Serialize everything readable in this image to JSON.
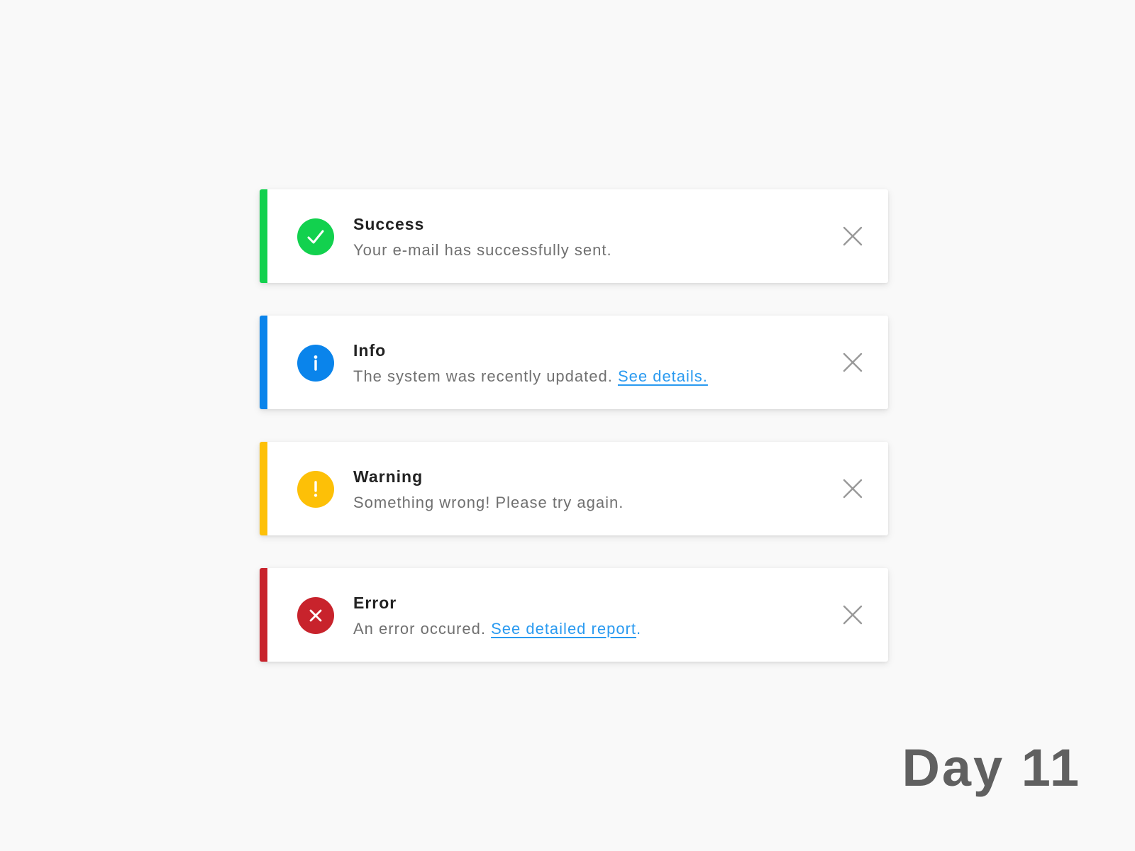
{
  "colors": {
    "success": "#12d14e",
    "info": "#0a84eb",
    "warning": "#fdc007",
    "error": "#c8232c",
    "link": "#2a9af0",
    "close": "#999999"
  },
  "alerts": [
    {
      "type": "success",
      "icon": "check-circle-icon",
      "title": "Success",
      "message": "Your e-mail has successfully sent.",
      "link_text": "",
      "after_link": ""
    },
    {
      "type": "info",
      "icon": "info-circle-icon",
      "title": "Info",
      "message": "The system was recently updated.",
      "link_text": "See details.",
      "after_link": ""
    },
    {
      "type": "warning",
      "icon": "exclamation-circle-icon",
      "title": "Warning",
      "message": "Something wrong! Please try again.",
      "link_text": "",
      "after_link": ""
    },
    {
      "type": "error",
      "icon": "x-circle-icon",
      "title": "Error",
      "message": "An error occured.",
      "link_text": "See detailed report",
      "after_link": "."
    }
  ],
  "close_icon": "close-icon",
  "footer": {
    "day_label": "Day 11"
  }
}
